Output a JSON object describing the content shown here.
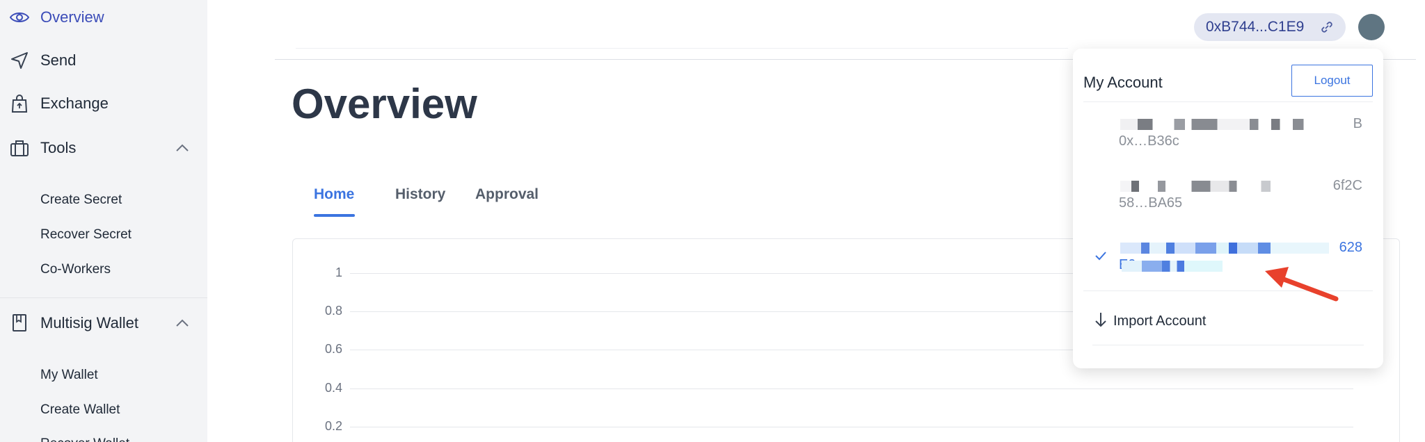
{
  "sidebar": {
    "items": [
      {
        "label": "Overview",
        "icon": "eye-icon"
      },
      {
        "label": "Send",
        "icon": "send-icon"
      },
      {
        "label": "Exchange",
        "icon": "shopping-bag-icon"
      },
      {
        "label": "Tools",
        "icon": "toolbox-icon"
      },
      {
        "label": "Multisig Wallet",
        "icon": "book-icon"
      }
    ],
    "tools_sub": [
      "Create Secret",
      "Recover Secret",
      "Co-Workers"
    ],
    "wallet_sub": [
      "My Wallet",
      "Create Wallet",
      "Recover Wallet"
    ]
  },
  "main": {
    "title": "Overview",
    "tabs": [
      "Home",
      "History",
      "Approval"
    ],
    "chart_data": {
      "type": "line",
      "y_ticks": [
        "1",
        "0.8",
        "0.6",
        "0.4",
        "0.2"
      ],
      "ylim": [
        0,
        1
      ],
      "grid": true
    }
  },
  "header": {
    "address": "0xB744...C1E9",
    "avatar_color": "#5f7582"
  },
  "account_menu": {
    "title": "My Account",
    "logout_label": "Logout",
    "accounts": [
      {
        "line1": "B",
        "line2": "0x…B36c",
        "selected": false
      },
      {
        "line1": "6f2C",
        "line2": "58…BA65",
        "selected": false
      },
      {
        "line1": "628",
        "line2": "E9",
        "selected": true
      }
    ],
    "import_label": "Import Account"
  },
  "colors": {
    "accent": "#3b74e0",
    "active_nav": "#3b4cb8",
    "annotation_arrow": "#e8412c"
  }
}
